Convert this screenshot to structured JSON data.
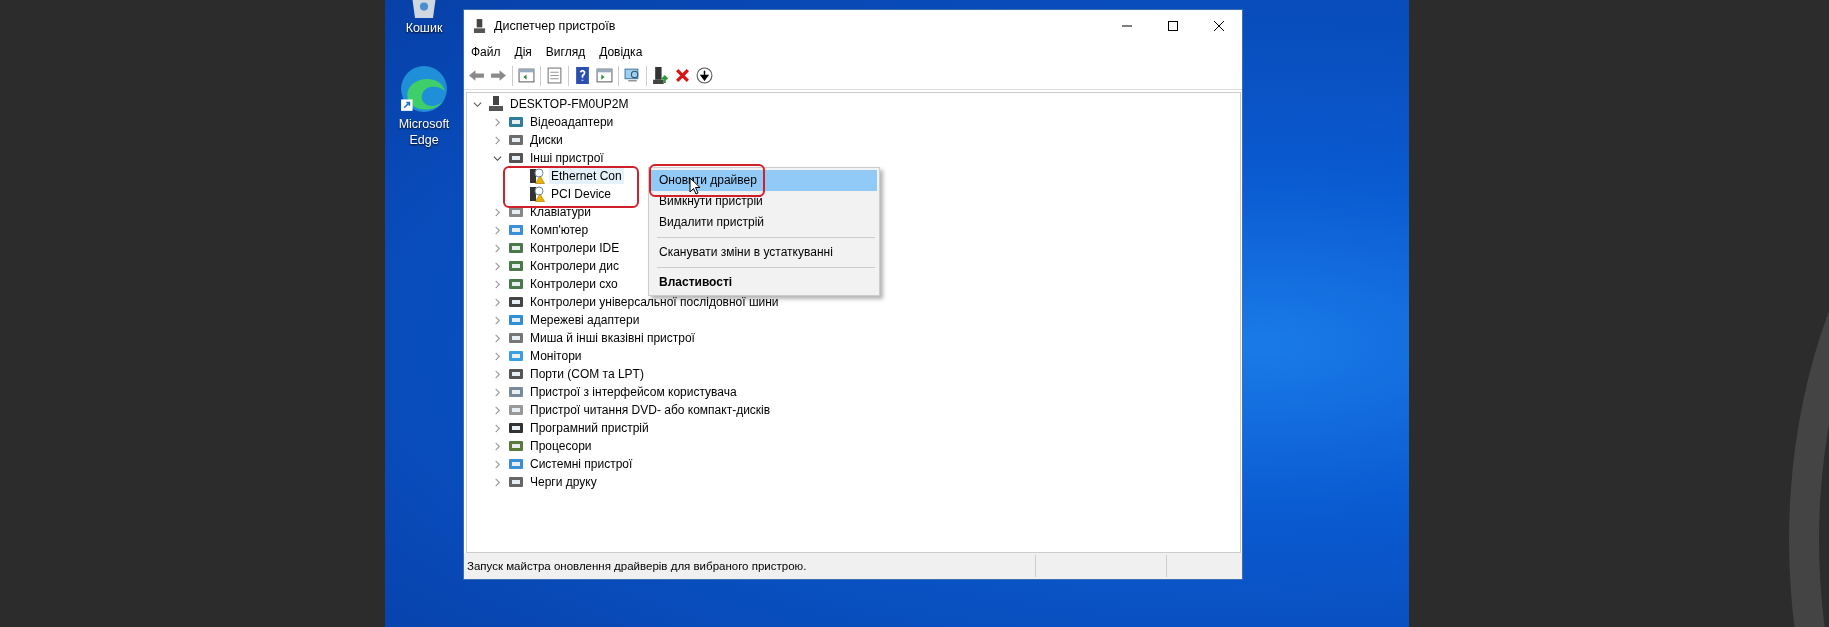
{
  "desktop_icons": [
    {
      "label": "Кошик"
    },
    {
      "label": "Microsoft Edge"
    }
  ],
  "window": {
    "title": "Диспетчер пристроїв"
  },
  "menu": [
    "Файл",
    "Дія",
    "Вигляд",
    "Довідка"
  ],
  "tree": {
    "label": "DESKTOP-FM0UP2M",
    "expanded": true,
    "children": [
      {
        "label": "Відеоадаптери",
        "expanded": false
      },
      {
        "label": "Диски",
        "expanded": false
      },
      {
        "label": "Інші пристрої",
        "expanded": true,
        "children": [
          {
            "label": "Ethernet Con",
            "selected": true
          },
          {
            "label": "PCI Device",
            "selected": false
          }
        ]
      },
      {
        "label": "Клавіатури",
        "expanded": false
      },
      {
        "label": "Комп'ютер",
        "expanded": false
      },
      {
        "label": "Контролери IDE",
        "expanded": false
      },
      {
        "label": "Контролери дис",
        "expanded": false
      },
      {
        "label": "Контролери схо",
        "expanded": false
      },
      {
        "label": "Контролери універсальної послідовної шини",
        "expanded": false
      },
      {
        "label": "Мережеві адаптери",
        "expanded": false
      },
      {
        "label": "Миша й інші вказівні пристрої",
        "expanded": false
      },
      {
        "label": "Монітори",
        "expanded": false
      },
      {
        "label": "Порти (COM та LPT)",
        "expanded": false
      },
      {
        "label": "Пристрої з інтерфейсом користувача",
        "expanded": false
      },
      {
        "label": "Пристрої читання DVD- або компакт-дисків",
        "expanded": false
      },
      {
        "label": "Програмний пристрій",
        "expanded": false
      },
      {
        "label": "Процесори",
        "expanded": false
      },
      {
        "label": "Системні пристрої",
        "expanded": false
      },
      {
        "label": "Черги друку",
        "expanded": false
      }
    ]
  },
  "context_menu": [
    {
      "kind": "item",
      "label": "Оновити драйвер",
      "selected": true,
      "default": false
    },
    {
      "kind": "item",
      "label": "Вимкнути пристрій",
      "selected": false,
      "default": false
    },
    {
      "kind": "item",
      "label": "Видалити пристрій",
      "selected": false,
      "default": false
    },
    {
      "kind": "separator"
    },
    {
      "kind": "item",
      "label": "Сканувати зміни в устаткуванні",
      "selected": false,
      "default": false
    },
    {
      "kind": "separator"
    },
    {
      "kind": "item",
      "label": "Властивості",
      "selected": false,
      "default": true
    }
  ],
  "status_bar": {
    "text": "Запуск майстра оновлення драйверів для вибраного пристрою."
  }
}
